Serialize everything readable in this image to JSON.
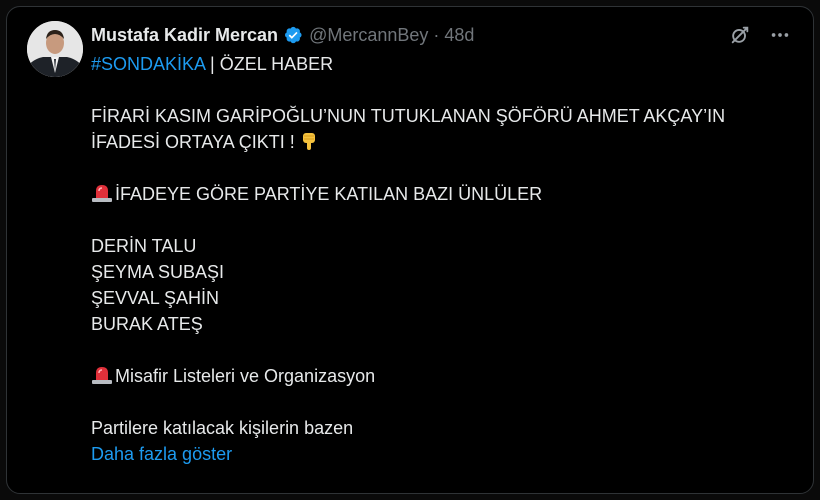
{
  "tweet": {
    "author_name": "Mustafa Kadir Mercan",
    "handle": "@MercannBey",
    "separator": "·",
    "time": "48d",
    "hashtag": "#SONDAKİKA",
    "header_rest": " | ÖZEL HABER",
    "headline_line1": "FİRARİ KASIM GARİPOĞLU’NUN TUTUKLANAN ŞÖFÖRÜ AHMET AKÇAY’IN",
    "headline_line2": "İFADESİ ORTAYA ÇIKTI !",
    "section1_title": "İFADEYE GÖRE PARTİYE KATILAN BAZI ÜNLÜLER",
    "names": [
      "DERİN TALU",
      "ŞEYMA SUBAŞI",
      "ŞEVVAL ŞAHİN",
      "BURAK ATEŞ"
    ],
    "section2_title": "Misafir Listeleri ve Organizasyon",
    "truncated_text": "Partilere katılacak kişilerin bazen",
    "show_more": "Daha fazla göster"
  },
  "icons": {
    "verified": "verified-badge-icon",
    "grok": "grok-icon",
    "more": "more-options-icon",
    "pointing_down": "backhand-index-pointing-down-emoji",
    "siren": "police-car-light-emoji"
  },
  "colors": {
    "background": "#000000",
    "text": "#e7e9ea",
    "muted": "#71767b",
    "accent": "#1d9bf0"
  }
}
